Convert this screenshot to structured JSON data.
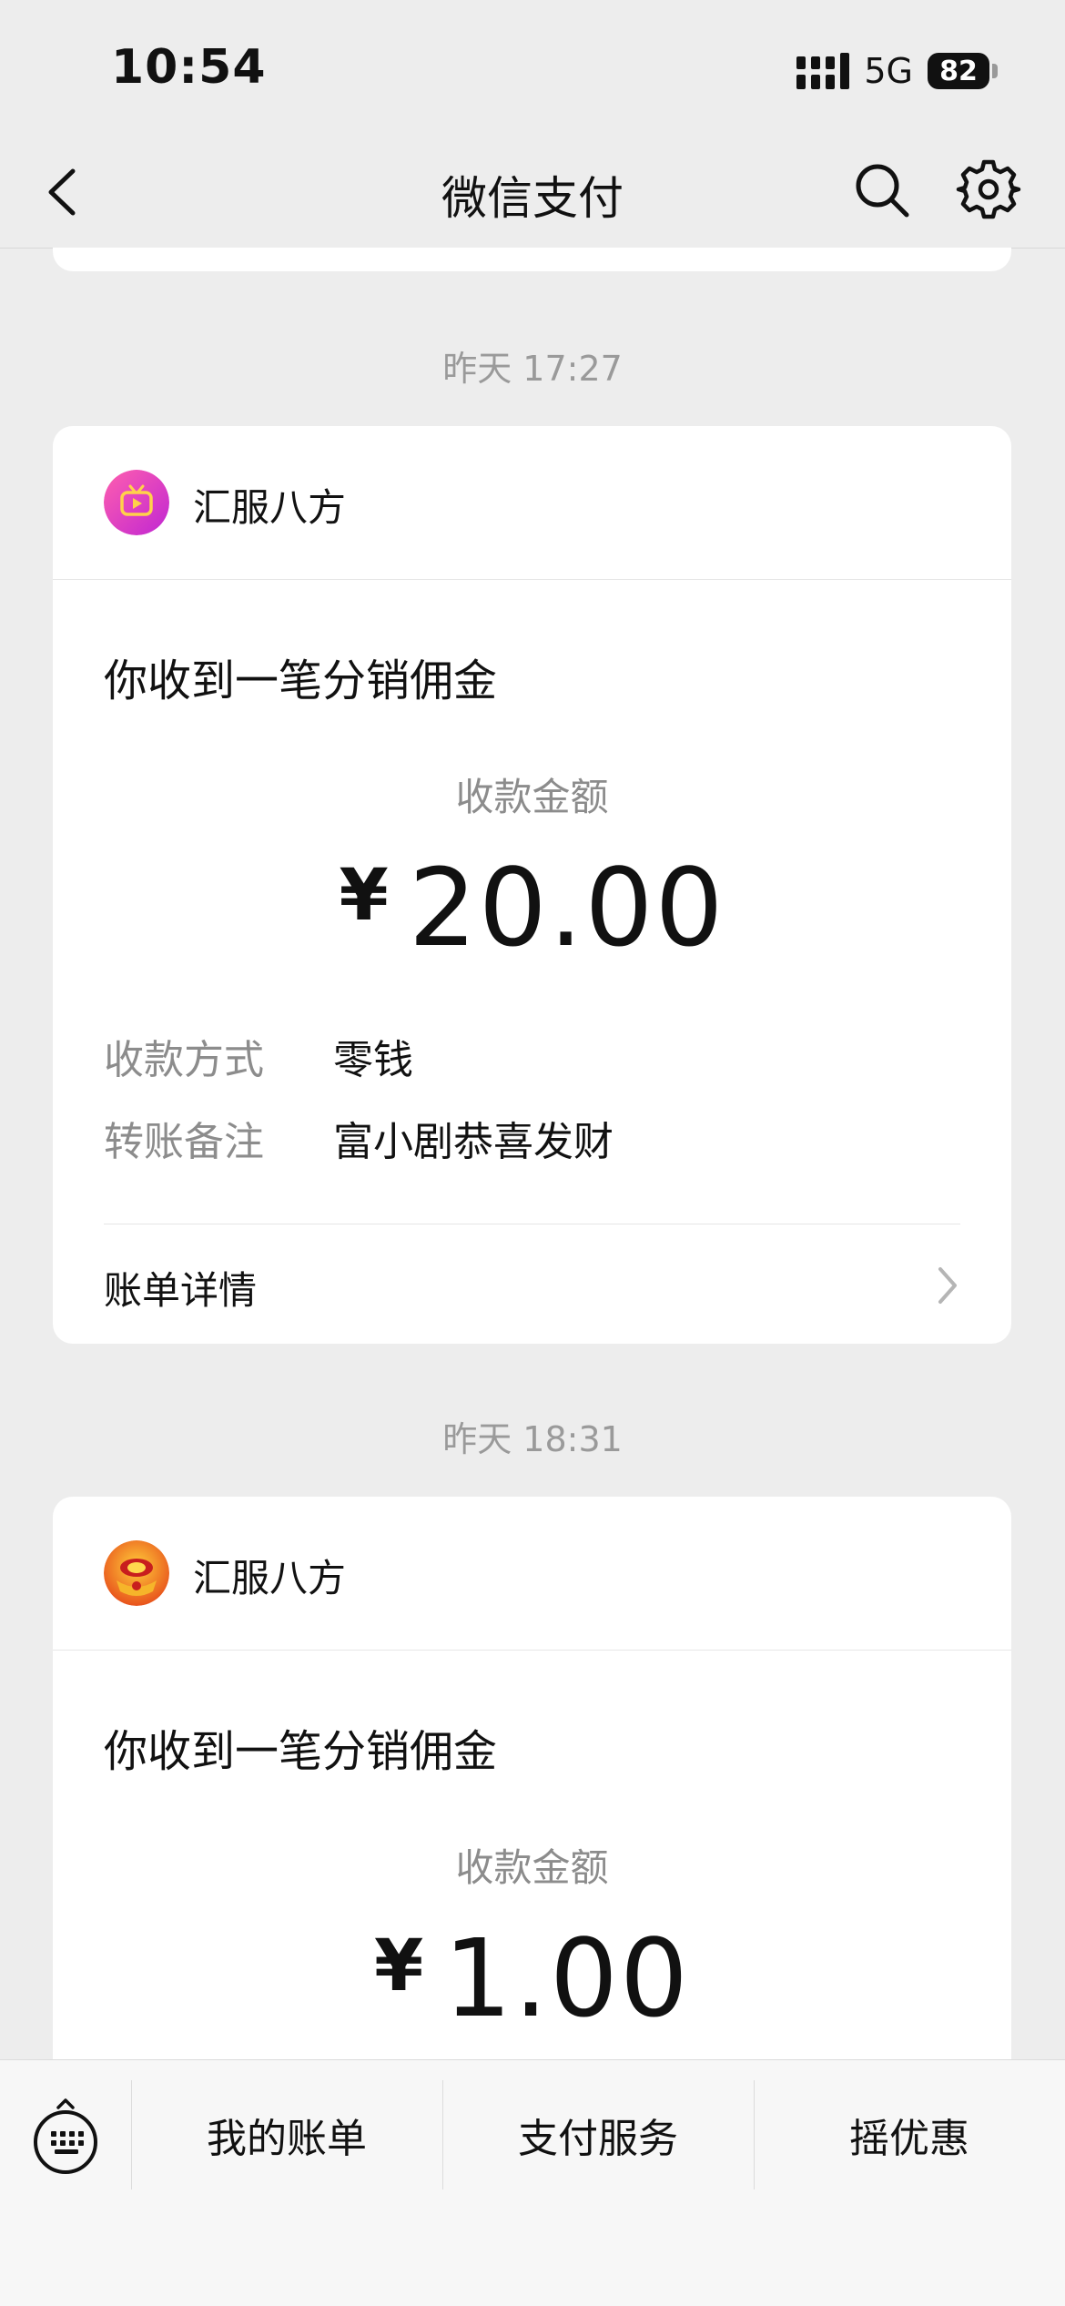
{
  "status_bar": {
    "time": "10:54",
    "network": "5G",
    "battery": "82"
  },
  "nav": {
    "title": "微信支付"
  },
  "messages": [
    {
      "timestamp": "昨天 17:27",
      "merchant": "汇服八方",
      "title": "你收到一笔分销佣金",
      "amount_label": "收款金额",
      "currency": "¥",
      "amount": "20.00",
      "details": [
        {
          "key": "收款方式",
          "value": "零钱"
        },
        {
          "key": "转账备注",
          "value": "富小剧恭喜发财"
        }
      ],
      "link_label": "账单详情"
    },
    {
      "timestamp": "昨天 18:31",
      "merchant": "汇服八方",
      "title": "你收到一笔分销佣金",
      "amount_label": "收款金额",
      "currency": "¥",
      "amount": "1.00"
    }
  ],
  "tab_bar": {
    "items": [
      "我的账单",
      "支付服务",
      "摇优惠"
    ]
  }
}
